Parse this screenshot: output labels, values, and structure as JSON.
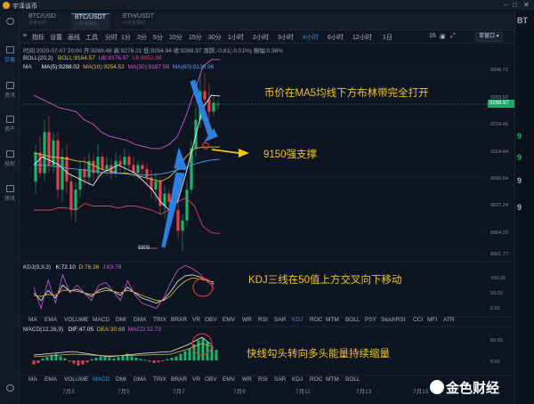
{
  "app": {
    "title": "宇泽谈币"
  },
  "left_nav": [
    {
      "label": "交易",
      "active": true
    },
    {
      "label": "资讯"
    },
    {
      "label": "资产"
    },
    {
      "label": "投权"
    },
    {
      "label": "快讯"
    }
  ],
  "tabs": [
    {
      "label": "BTC/USD",
      "sub": "币安合约"
    },
    {
      "label": "BTC/USDT",
      "sub": "火币全球站",
      "active": true
    },
    {
      "label": "ETH/USDT",
      "sub": "火币全球站"
    }
  ],
  "toolbar": {
    "items": [
      "指标",
      "设置",
      "画线",
      "工具",
      "分时",
      "1分",
      "3分",
      "5分",
      "10分",
      "15分",
      "30分",
      "1小时",
      "2小时",
      "3小时",
      "4小时",
      "6小时",
      "12小时",
      "1日"
    ],
    "active": "4小时",
    "size_label": "16",
    "mode_label": "单窗口"
  },
  "ohlc": "时间:2020-07-07 20:00  开:9269.48  高:9278.21  低:9254.94  收:9268.97  涨跌:-0.81(-0.01%)  振幅:0.36%",
  "boll_line": {
    "name": "BOLL(20,2)",
    "mid": "BOLL:9164.57",
    "ub": "UB:9376.97",
    "lb": "LB:8952.96"
  },
  "ma_line": {
    "name": "MA",
    "ma5": "MA(5):9288.02",
    "ma10": "MA(10):9254.52",
    "ma30": "MA(30):9187.58",
    "ma60": "MA(60):9133.96"
  },
  "price_axis": [
    "9348.72",
    "9283.59",
    "9218.46",
    "9154.44",
    "9090.64",
    "9027.24",
    "8964.29",
    "8901.77"
  ],
  "last_price": "9268.97",
  "low_marker": "8909",
  "kdj_line": {
    "name": "KDJ(9,3,3)",
    "k": "K:72.10",
    "d": "D:76.26",
    "j": "J:63.78"
  },
  "kdj_axis": [
    "100.00",
    "50.00",
    "0.00"
  ],
  "macd_line": {
    "name": "MACD(12,26,9)",
    "dif": "DIF:47.05",
    "dea": "DEA:30.69",
    "macd": "MACD:32.73"
  },
  "macd_axis": [
    "50.00",
    "0.00"
  ],
  "indicators": [
    "MA",
    "EMA",
    "VOLUME",
    "MACD",
    "DMI",
    "DMA",
    "TRIX",
    "BRAR",
    "VR",
    "OBV",
    "EMV",
    "WR",
    "RSI",
    "SAR",
    "KDJ",
    "ROC",
    "MTM",
    "BOLL",
    "PSY",
    "StochRSI",
    "CCI",
    "MFI",
    "ATR"
  ],
  "indicators_active_1": "KDJ",
  "indicators_active_2": "MACD",
  "dates": [
    "7月3",
    "7月5",
    "7月7",
    "7月9",
    "7月11",
    "7月13",
    "7月15"
  ],
  "annotations": {
    "a1": "币价在MA5均线下方布林带完全打开",
    "a2": "9150强支撑",
    "a3": "KDJ三线在50值上方交叉向下移动",
    "a4": "快线勾头转向多头能量持续缩量"
  },
  "watermark": "金色财经",
  "right_panel": [
    "BT",
    "9",
    "9",
    "9",
    "9"
  ],
  "colors": {
    "up": "#19b56c",
    "down": "#e0414a",
    "annot": "#f5c518",
    "arrow": "#3a8ee6",
    "accent": "#3a8ee6"
  }
}
